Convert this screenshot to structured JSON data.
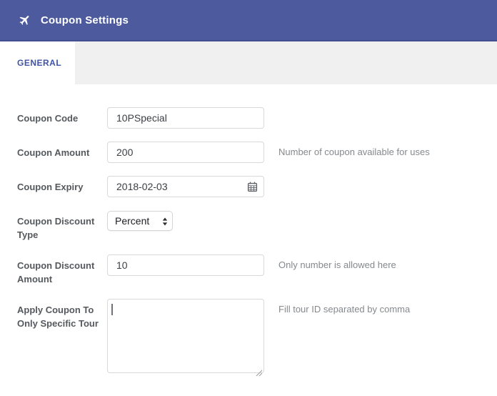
{
  "header": {
    "title": "Coupon Settings",
    "icon": "airplane-icon"
  },
  "tabs": {
    "general": "GENERAL"
  },
  "form": {
    "fields": [
      {
        "label": "Coupon Code",
        "value": "10PSpecial",
        "help": ""
      },
      {
        "label": "Coupon Amount",
        "value": "200",
        "help": "Number of coupon available for uses"
      },
      {
        "label": "Coupon Expiry",
        "value": "2018-02-03",
        "help": "",
        "icon": "calendar-icon"
      },
      {
        "label": "Coupon Discount Type",
        "value": "Percent",
        "help": ""
      },
      {
        "label": "Coupon Discount Amount",
        "value": "10",
        "help": "Only number is allowed here"
      },
      {
        "label": "Apply Coupon To Only Specific Tour",
        "value": "",
        "help": "Fill tour ID separated by comma"
      }
    ]
  },
  "colors": {
    "header_bg": "#4d5b9e",
    "header_border": "#42508f",
    "tab_bar_bg": "#f0f0f0",
    "tab_active_text": "#4054a8",
    "label_text": "#55595d",
    "help_text": "#85898d",
    "input_border": "#d9d9d9"
  }
}
